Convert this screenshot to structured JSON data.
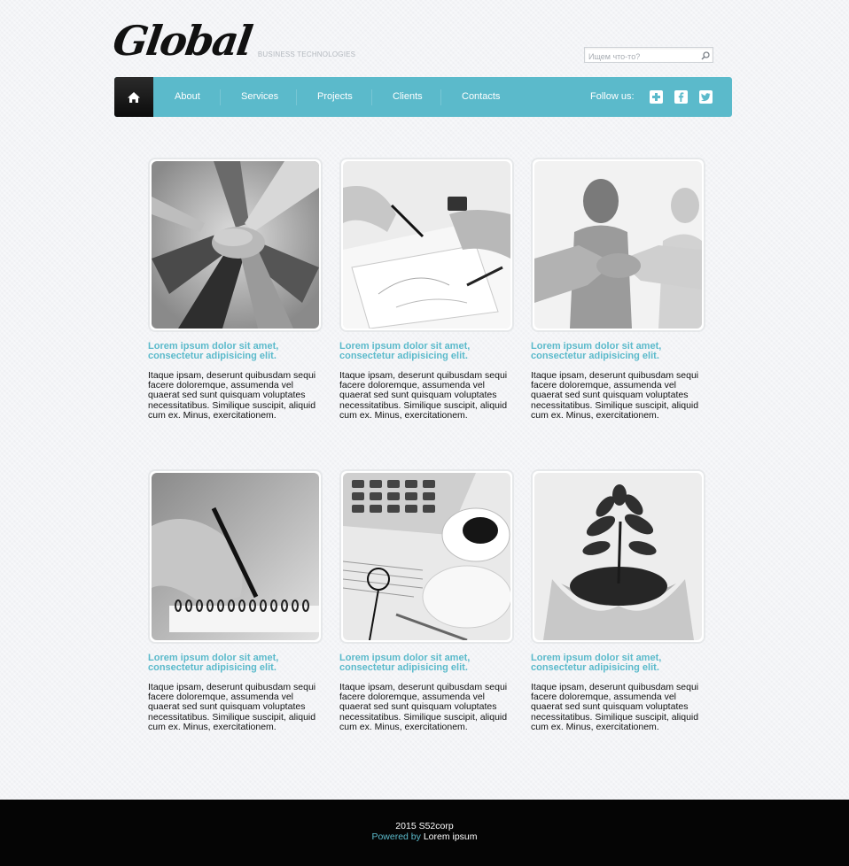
{
  "header": {
    "logo_text": "Global",
    "tagline": "BUSINESS TECHNOLOGIES",
    "search_placeholder": "Ищем что-то?"
  },
  "nav": {
    "items": [
      "About",
      "Services",
      "Projects",
      "Clients",
      "Contacts"
    ],
    "follow_label": "Follow us:",
    "social": [
      "plus-icon",
      "facebook-icon",
      "twitter-icon"
    ]
  },
  "cards": [
    {
      "title": "Lorem ipsum dolor sit amet, consectetur adipisicing elit.",
      "text": "Itaque ipsam, deserunt quibusdam sequi facere doloremque, assumenda vel quaerat sed sunt quisquam voluptates necessitatibus. Similique suscipit, aliquid cum ex. Minus, exercitationem.",
      "image": "hands-together"
    },
    {
      "title": "Lorem ipsum dolor sit amet, consectetur adipisicing elit.",
      "text": "Itaque ipsam, deserunt quibusdam sequi facere doloremque, assumenda vel quaerat sed sunt quisquam voluptates necessitatibus. Similique suscipit, aliquid cum ex. Minus, exercitationem.",
      "image": "planning-documents"
    },
    {
      "title": "Lorem ipsum dolor sit amet, consectetur adipisicing elit.",
      "text": "Itaque ipsam, deserunt quibusdam sequi facere doloremque, assumenda vel quaerat sed sunt quisquam voluptates necessitatibus. Similique suscipit, aliquid cum ex. Minus, exercitationem.",
      "image": "handshake"
    },
    {
      "title": "Lorem ipsum dolor sit amet, consectetur adipisicing elit.",
      "text": "Itaque ipsam, deserunt quibusdam sequi facere doloremque, assumenda vel quaerat sed sunt quisquam voluptates necessitatibus. Similique suscipit, aliquid cum ex. Minus, exercitationem.",
      "image": "writing-notebook"
    },
    {
      "title": "Lorem ipsum dolor sit amet, consectetur adipisicing elit.",
      "text": "Itaque ipsam, deserunt quibusdam sequi facere doloremque, assumenda vel quaerat sed sunt quisquam voluptates necessitatibus. Similique suscipit, aliquid cum ex. Minus, exercitationem.",
      "image": "calculator-coffee"
    },
    {
      "title": "Lorem ipsum dolor sit amet, consectetur adipisicing elit.",
      "text": "Itaque ipsam, deserunt quibusdam sequi facere doloremque, assumenda vel quaerat sed sunt quisquam voluptates necessitatibus. Similique suscipit, aliquid cum ex. Minus, exercitationem.",
      "image": "plant-in-hands"
    }
  ],
  "footer": {
    "copyright": "2015 S52corp",
    "powered_by": "Powered by",
    "powered_name": "Lorem ipsum"
  },
  "colors": {
    "accent": "#5bbacb",
    "background": "#f3f4f7",
    "footer": "#050505"
  }
}
